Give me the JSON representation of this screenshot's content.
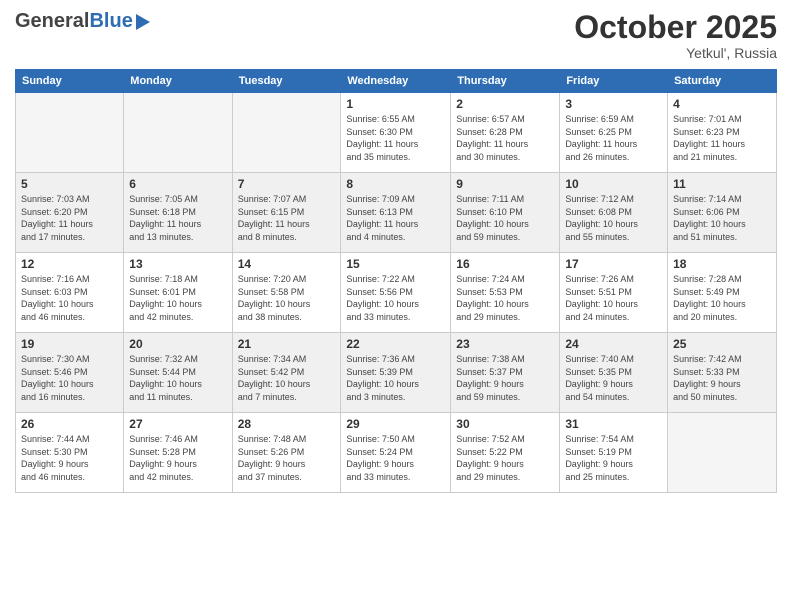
{
  "header": {
    "logo_general": "General",
    "logo_blue": "Blue",
    "month_title": "October 2025",
    "location": "Yetkul', Russia"
  },
  "weekdays": [
    "Sunday",
    "Monday",
    "Tuesday",
    "Wednesday",
    "Thursday",
    "Friday",
    "Saturday"
  ],
  "weeks": [
    [
      {
        "day": "",
        "info": ""
      },
      {
        "day": "",
        "info": ""
      },
      {
        "day": "",
        "info": ""
      },
      {
        "day": "1",
        "info": "Sunrise: 6:55 AM\nSunset: 6:30 PM\nDaylight: 11 hours\nand 35 minutes."
      },
      {
        "day": "2",
        "info": "Sunrise: 6:57 AM\nSunset: 6:28 PM\nDaylight: 11 hours\nand 30 minutes."
      },
      {
        "day": "3",
        "info": "Sunrise: 6:59 AM\nSunset: 6:25 PM\nDaylight: 11 hours\nand 26 minutes."
      },
      {
        "day": "4",
        "info": "Sunrise: 7:01 AM\nSunset: 6:23 PM\nDaylight: 11 hours\nand 21 minutes."
      }
    ],
    [
      {
        "day": "5",
        "info": "Sunrise: 7:03 AM\nSunset: 6:20 PM\nDaylight: 11 hours\nand 17 minutes."
      },
      {
        "day": "6",
        "info": "Sunrise: 7:05 AM\nSunset: 6:18 PM\nDaylight: 11 hours\nand 13 minutes."
      },
      {
        "day": "7",
        "info": "Sunrise: 7:07 AM\nSunset: 6:15 PM\nDaylight: 11 hours\nand 8 minutes."
      },
      {
        "day": "8",
        "info": "Sunrise: 7:09 AM\nSunset: 6:13 PM\nDaylight: 11 hours\nand 4 minutes."
      },
      {
        "day": "9",
        "info": "Sunrise: 7:11 AM\nSunset: 6:10 PM\nDaylight: 10 hours\nand 59 minutes."
      },
      {
        "day": "10",
        "info": "Sunrise: 7:12 AM\nSunset: 6:08 PM\nDaylight: 10 hours\nand 55 minutes."
      },
      {
        "day": "11",
        "info": "Sunrise: 7:14 AM\nSunset: 6:06 PM\nDaylight: 10 hours\nand 51 minutes."
      }
    ],
    [
      {
        "day": "12",
        "info": "Sunrise: 7:16 AM\nSunset: 6:03 PM\nDaylight: 10 hours\nand 46 minutes."
      },
      {
        "day": "13",
        "info": "Sunrise: 7:18 AM\nSunset: 6:01 PM\nDaylight: 10 hours\nand 42 minutes."
      },
      {
        "day": "14",
        "info": "Sunrise: 7:20 AM\nSunset: 5:58 PM\nDaylight: 10 hours\nand 38 minutes."
      },
      {
        "day": "15",
        "info": "Sunrise: 7:22 AM\nSunset: 5:56 PM\nDaylight: 10 hours\nand 33 minutes."
      },
      {
        "day": "16",
        "info": "Sunrise: 7:24 AM\nSunset: 5:53 PM\nDaylight: 10 hours\nand 29 minutes."
      },
      {
        "day": "17",
        "info": "Sunrise: 7:26 AM\nSunset: 5:51 PM\nDaylight: 10 hours\nand 24 minutes."
      },
      {
        "day": "18",
        "info": "Sunrise: 7:28 AM\nSunset: 5:49 PM\nDaylight: 10 hours\nand 20 minutes."
      }
    ],
    [
      {
        "day": "19",
        "info": "Sunrise: 7:30 AM\nSunset: 5:46 PM\nDaylight: 10 hours\nand 16 minutes."
      },
      {
        "day": "20",
        "info": "Sunrise: 7:32 AM\nSunset: 5:44 PM\nDaylight: 10 hours\nand 11 minutes."
      },
      {
        "day": "21",
        "info": "Sunrise: 7:34 AM\nSunset: 5:42 PM\nDaylight: 10 hours\nand 7 minutes."
      },
      {
        "day": "22",
        "info": "Sunrise: 7:36 AM\nSunset: 5:39 PM\nDaylight: 10 hours\nand 3 minutes."
      },
      {
        "day": "23",
        "info": "Sunrise: 7:38 AM\nSunset: 5:37 PM\nDaylight: 9 hours\nand 59 minutes."
      },
      {
        "day": "24",
        "info": "Sunrise: 7:40 AM\nSunset: 5:35 PM\nDaylight: 9 hours\nand 54 minutes."
      },
      {
        "day": "25",
        "info": "Sunrise: 7:42 AM\nSunset: 5:33 PM\nDaylight: 9 hours\nand 50 minutes."
      }
    ],
    [
      {
        "day": "26",
        "info": "Sunrise: 7:44 AM\nSunset: 5:30 PM\nDaylight: 9 hours\nand 46 minutes."
      },
      {
        "day": "27",
        "info": "Sunrise: 7:46 AM\nSunset: 5:28 PM\nDaylight: 9 hours\nand 42 minutes."
      },
      {
        "day": "28",
        "info": "Sunrise: 7:48 AM\nSunset: 5:26 PM\nDaylight: 9 hours\nand 37 minutes."
      },
      {
        "day": "29",
        "info": "Sunrise: 7:50 AM\nSunset: 5:24 PM\nDaylight: 9 hours\nand 33 minutes."
      },
      {
        "day": "30",
        "info": "Sunrise: 7:52 AM\nSunset: 5:22 PM\nDaylight: 9 hours\nand 29 minutes."
      },
      {
        "day": "31",
        "info": "Sunrise: 7:54 AM\nSunset: 5:19 PM\nDaylight: 9 hours\nand 25 minutes."
      },
      {
        "day": "",
        "info": ""
      }
    ]
  ]
}
